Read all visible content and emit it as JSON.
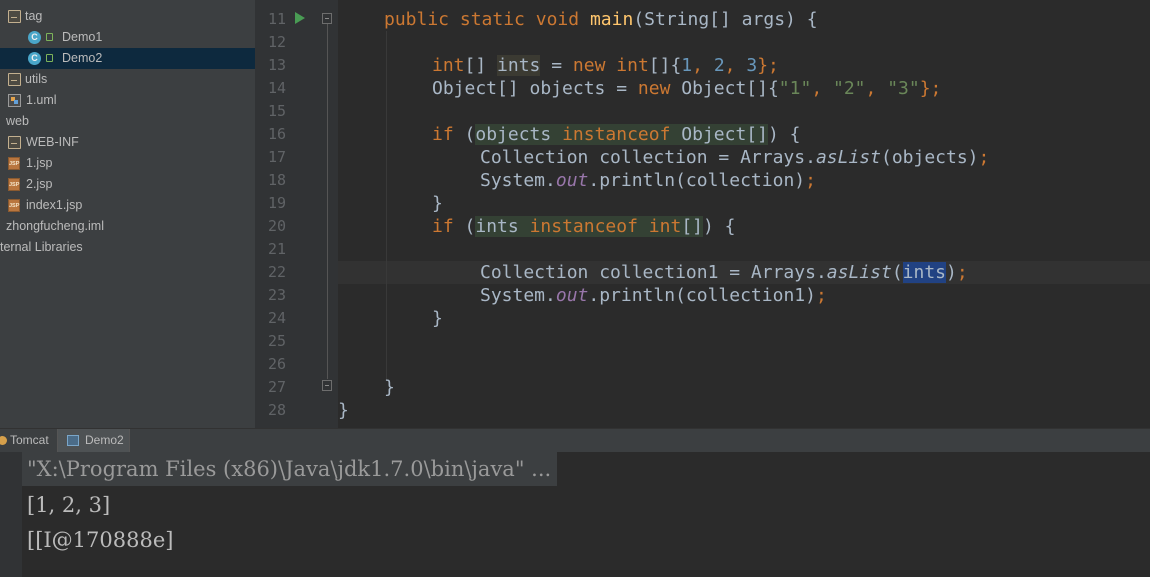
{
  "project_tree": {
    "items": [
      {
        "label": "tag",
        "icon": "folder-icon"
      },
      {
        "label": "Demo1",
        "icon": "java-class-icon"
      },
      {
        "label": "Demo2",
        "icon": "java-class-icon",
        "selected": true
      },
      {
        "label": "utils",
        "icon": "folder-icon"
      },
      {
        "label": "1.uml",
        "icon": "uml-file-icon"
      },
      {
        "label": "web",
        "icon": "folder-icon"
      },
      {
        "label": "WEB-INF",
        "icon": "folder-icon"
      },
      {
        "label": "1.jsp",
        "icon": "jsp-file-icon"
      },
      {
        "label": "2.jsp",
        "icon": "jsp-file-icon"
      },
      {
        "label": "index1.jsp",
        "icon": "jsp-file-icon"
      },
      {
        "label": "zhongfucheng.iml",
        "icon": "module-file-icon"
      },
      {
        "label": "ternal Libraries",
        "icon": "library-icon"
      }
    ],
    "class_icon_letter": "C",
    "jsp_icon_text": "JSP"
  },
  "editor": {
    "line_numbers": [
      "11",
      "12",
      "13",
      "14",
      "15",
      "16",
      "17",
      "18",
      "19",
      "20",
      "21",
      "22",
      "23",
      "24",
      "25",
      "26",
      "27",
      "28"
    ],
    "code": {
      "l11": {
        "public": "public",
        "static": "static",
        "void": "void",
        "name": "main",
        "rest": "(String[] args) {"
      },
      "l13": {
        "type": "int",
        "b1": "[] ",
        "var": "ints",
        "eq": " = ",
        "new": "new",
        "sp": " ",
        "type2": "int",
        "b2": "[]{",
        "n1": "1",
        "c1": ", ",
        "n2": "2",
        "c2": ", ",
        "n3": "3",
        "end": "};"
      },
      "l14": {
        "a": "Object[] objects = ",
        "new": "new",
        "b": " Object[]{",
        "s1": "\"1\"",
        "c1": ", ",
        "s2": "\"2\"",
        "c2": ", ",
        "s3": "\"3\"",
        "end": "};"
      },
      "l16": {
        "if": "if",
        "p": " (",
        "var": "objects",
        "sp": " ",
        "inst": "instanceof",
        "type": " Object[]",
        "end": ") {"
      },
      "l17": {
        "a": "Collection collection = Arrays.",
        "m": "asList",
        "b": "(objects)",
        "semi": ";"
      },
      "l18": {
        "a": "System.",
        "f": "out",
        "b": ".println(collection)",
        "semi": ";"
      },
      "l19": {
        "a": "}"
      },
      "l20": {
        "if": "if",
        "p": " (",
        "var": "ints",
        "sp": " ",
        "inst": "instanceof",
        "sp2": " ",
        "type": "int",
        "br": "[]",
        "end": ") {"
      },
      "l22": {
        "a": "Collection collection1 = Arrays.",
        "m": "asList",
        "p": "(",
        "arg": "ints",
        "end": ")",
        "semi": ";"
      },
      "l23": {
        "a": "System.",
        "f": "out",
        "b": ".println(collection1)",
        "semi": ";"
      },
      "l24": {
        "a": "}"
      },
      "l27": {
        "a": "}"
      },
      "l28": {
        "a": "}"
      }
    }
  },
  "run_panel": {
    "tabs": [
      {
        "label": "Tomcat",
        "icon": "tomcat-icon"
      },
      {
        "label": "Demo2",
        "icon": "application-icon",
        "active": true
      }
    ],
    "output": [
      "\"X:\\Program Files (x86)\\Java\\jdk1.7.0\\bin\\java\" ...",
      "[1, 2, 3]",
      "[[I@170888e]"
    ]
  },
  "colors": {
    "keyword": "#cc7832",
    "method_decl": "#ffc66d",
    "number": "#6897bb",
    "string": "#6a8759",
    "static_field": "#9876aa",
    "text": "#a9b7c6",
    "selection": "#214283"
  }
}
